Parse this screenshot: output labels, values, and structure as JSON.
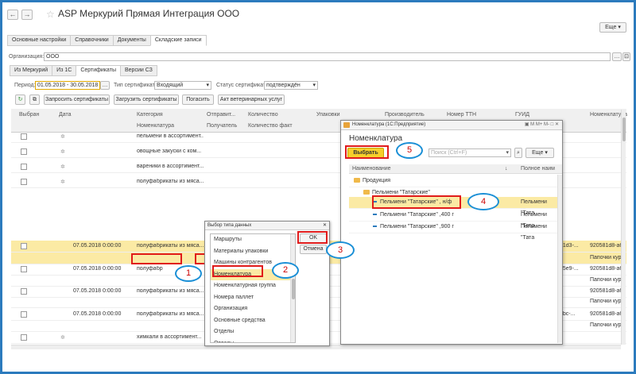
{
  "window": {
    "title": "ASP Меркурий Прямая Интеграция ООО",
    "more": "Еще",
    "back": "←",
    "forward": "→",
    "star": "☆"
  },
  "tabs": [
    "Основные настройки",
    "Справочники",
    "Документы",
    "Складские записи"
  ],
  "org": {
    "label": "Организация:",
    "value": "ООО"
  },
  "subtabs": [
    "Из Меркурий",
    "Из 1С",
    "Сертификаты",
    "Версии СЗ"
  ],
  "filter": {
    "period_label": "Период:",
    "period_value": "01.05.2018 - 30.05.2018",
    "type_label": "Тип сертификата:",
    "type_value": "Входящий",
    "status_label": "Статус сертификата:",
    "status_value": "подтверждён"
  },
  "toolbar": {
    "request": "Запросить сертификаты",
    "load": "Загрузить сертификаты",
    "redeem": "Погасить",
    "act": "Акт ветеринарных услуг"
  },
  "grid": {
    "headers": {
      "selected": "Выбран",
      "date": "Дата",
      "category": "Категория",
      "nomenclature": "Номенклатура",
      "sender": "Отправит...",
      "receiver": "Получатель",
      "qty": "Количество",
      "qty_fact": "Количество факт",
      "pack": "Упаковки",
      "producer": "Производитель",
      "ttn": "Номер ТТН",
      "guid": "ГУИД",
      "nom2": "Номенклатура"
    },
    "rows": [
      {
        "date": "",
        "cat": "пельмени в ассортимент...",
        "guid": "",
        "nom": ""
      },
      {
        "date": "",
        "cat": "овощные закуски с ком...",
        "guid": "",
        "nom": ""
      },
      {
        "date": "",
        "cat": "вареники в ассортимент...",
        "guid": "",
        "nom": ""
      },
      {
        "date": "",
        "cat": "полуфабрикаты из мяса...",
        "guid": "",
        "nom": ""
      },
      {
        "date": "07.05.2018 0:00:00",
        "cat": "полуфабрикаты из мяса...",
        "guid": "a1d3-...",
        "nom": "920581d8-а6"
      },
      {
        "date": "",
        "cat": "",
        "guid": "",
        "nom": "Папочки кур"
      },
      {
        "date": "07.05.2018 0:00:00",
        "cat": "полуфабр",
        "guid": "b5e9-...",
        "nom": "920581d8-а6"
      },
      {
        "date": "",
        "cat": "",
        "guid": "",
        "nom": "Папочки кур"
      },
      {
        "date": "07.05.2018 0:00:00",
        "cat": "полуфабрикаты из мяса...",
        "guid": "",
        "nom": "920581d8-а6"
      },
      {
        "date": "",
        "cat": "",
        "guid": "",
        "nom": "Папочки кур"
      },
      {
        "date": "07.05.2018 0:00:00",
        "cat": "полуфабрикаты из мяса...",
        "guid": "bbc-...",
        "nom": "920581d8-а6"
      },
      {
        "date": "",
        "cat": "",
        "guid": "",
        "nom": "Папочки кур"
      },
      {
        "date": "",
        "cat": "химкали в ассортимент...",
        "guid": "",
        "nom": ""
      }
    ]
  },
  "type_dialog": {
    "title": "Выбор типа данных",
    "items": [
      "Маршруты",
      "Материалы упаковки",
      "Машины контрагентов",
      "Номенклатура",
      "Номенклатурная группа",
      "Номера паллет",
      "Организация",
      "Основные средства",
      "Отделы",
      "Отделы"
    ],
    "ok": "OK",
    "cancel": "Отмена"
  },
  "nom_dialog": {
    "title": "Номенклатура (1С:Предприятие)",
    "heading": "Номенклатура",
    "select": "Выбрать",
    "search_placeholder": "Поиск (Ctrl+F)",
    "more": "Еще",
    "col_name": "Наименование",
    "col_full": "Полное наим",
    "tree": [
      {
        "name": "Продукция",
        "full": ""
      },
      {
        "name": "Пельмени \"Татарские\"",
        "full": ""
      },
      {
        "name": "Пельмени \"Татарские\" , н/ф",
        "full": "Пельмени \"Тата"
      },
      {
        "name": "Пельмени \"Татарские\" ,400 г",
        "full": "Пельмени \"Тата"
      },
      {
        "name": "Пельмени \"Татарские\" ,900 г",
        "full": "Пельмени \"Тата"
      }
    ]
  },
  "callouts": [
    "1",
    "2",
    "3",
    "4",
    "5"
  ]
}
